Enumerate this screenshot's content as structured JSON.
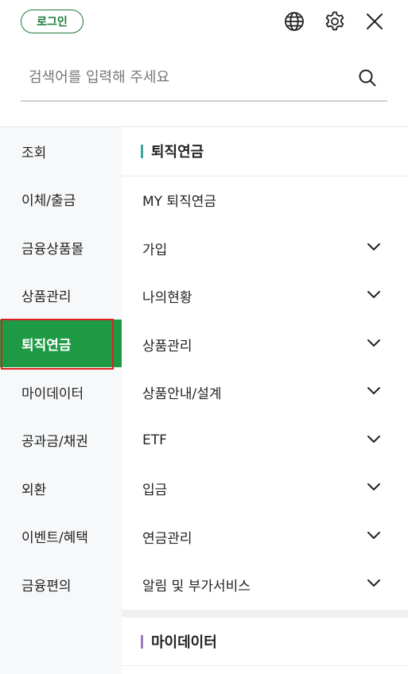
{
  "header": {
    "login_label": "로그인",
    "globe_icon": "globe-icon",
    "gear_icon": "gear-icon",
    "close_icon": "close-icon"
  },
  "search": {
    "placeholder": "검색어를 입력해 주세요",
    "icon": "search-icon"
  },
  "colors": {
    "brand_green": "#1a7a3a",
    "active_green": "#1f9a44",
    "highlight_red": "#e02020",
    "teal_bar": "#3aa7a0",
    "purple_bar": "#9b7cb6"
  },
  "left_nav": {
    "items": [
      {
        "label": "조회"
      },
      {
        "label": "이체/출금"
      },
      {
        "label": "금융상품몰"
      },
      {
        "label": "상품관리"
      },
      {
        "label": "퇴직연금",
        "active": true
      },
      {
        "label": "마이데이터"
      },
      {
        "label": "공과금/채권"
      },
      {
        "label": "외환"
      },
      {
        "label": "이벤트/혜택"
      },
      {
        "label": "금융편의"
      }
    ]
  },
  "right_panel": {
    "section1_title": "퇴직연금",
    "items": [
      {
        "label": "MY 퇴직연금",
        "expandable": false
      },
      {
        "label": "가입",
        "expandable": true
      },
      {
        "label": "나의현황",
        "expandable": true
      },
      {
        "label": "상품관리",
        "expandable": true
      },
      {
        "label": "상품안내/설계",
        "expandable": true
      },
      {
        "label": "ETF",
        "expandable": true
      },
      {
        "label": "입금",
        "expandable": true
      },
      {
        "label": "연금관리",
        "expandable": true
      },
      {
        "label": "알림 및 부가서비스",
        "expandable": true
      }
    ],
    "section2_title": "마이데이터"
  }
}
